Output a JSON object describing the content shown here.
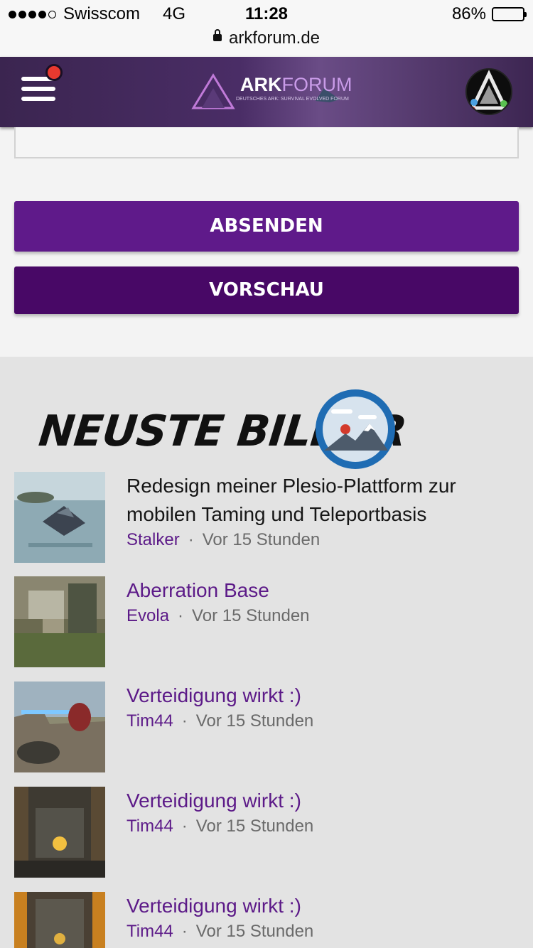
{
  "status_bar": {
    "carrier": "Swisscom",
    "network": "4G",
    "time": "11:28",
    "battery_percent": "86%",
    "battery_level": 0.86,
    "signal_bars": 4,
    "signal_max": 5
  },
  "address_bar": {
    "domain": "arkforum.de"
  },
  "header": {
    "logo_text_bold": "ARK",
    "logo_text_light": "FORUM",
    "logo_subtitle": "DEUTSCHES ARK: SURVIVAL EVOLVED FORUM",
    "logo_letters": "A R K",
    "notification": true
  },
  "form": {
    "submit_label": "ABSENDEN",
    "preview_label": "VORSCHAU"
  },
  "colors": {
    "accent": "#5f1a8a",
    "accent_dark": "#480866",
    "notification": "#e8392f",
    "link": "#5c1a88"
  },
  "latest_images": {
    "title": "NEUSTE BILDER",
    "icon": "mountain-icon",
    "items": [
      {
        "title": "Redesign meiner Plesio-Plattform zur mobilen Taming und Teleportbasis",
        "author": "Stalker",
        "time": "Vor 15 Stunden"
      },
      {
        "title": "Aberration Base",
        "author": "Evola",
        "time": "Vor 15 Stunden"
      },
      {
        "title": "Verteidigung wirkt :)",
        "author": "Tim44",
        "time": "Vor 15 Stunden"
      },
      {
        "title": "Verteidigung wirkt :)",
        "author": "Tim44",
        "time": "Vor 15 Stunden"
      },
      {
        "title": "Verteidigung wirkt :)",
        "author": "Tim44",
        "time": "Vor 15 Stunden"
      }
    ]
  }
}
